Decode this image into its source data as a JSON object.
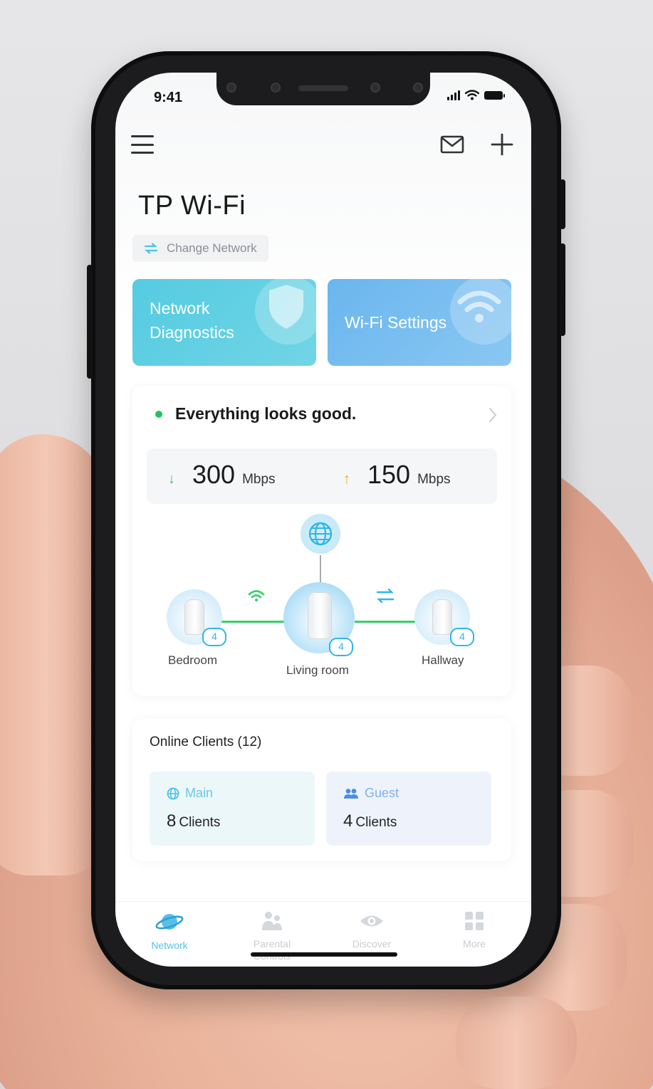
{
  "status_bar": {
    "time": "9:41"
  },
  "header": {
    "app_title": "TP Wi-Fi",
    "change_network_label": "Change Network"
  },
  "quick_actions": [
    {
      "label_line1": "Network",
      "label_line2": "Diagnostics",
      "icon": "shield-icon"
    },
    {
      "label": "Wi-Fi Settings",
      "icon": "wifi-icon"
    }
  ],
  "network_status": {
    "message": "Everything looks good.",
    "download": {
      "value": "300",
      "unit": "Mbps"
    },
    "upload": {
      "value": "150",
      "unit": "Mbps"
    }
  },
  "topology": {
    "nodes": [
      {
        "label": "Bedroom",
        "clients": "4"
      },
      {
        "label": "Living room",
        "clients": "4"
      },
      {
        "label": "Hallway",
        "clients": "4"
      }
    ]
  },
  "online_clients": {
    "title": "Online Clients (12)",
    "groups": [
      {
        "name": "Main",
        "count": "8",
        "count_label": "Clients"
      },
      {
        "name": "Guest",
        "count": "4",
        "count_label": "Clients"
      }
    ]
  },
  "tabbar": {
    "tabs": [
      {
        "label": "Network"
      },
      {
        "label": "Parental Controls"
      },
      {
        "label": "Discover"
      },
      {
        "label": "More"
      }
    ]
  },
  "colors": {
    "accent": "#56c0e6",
    "diagnostics_card": "#55cbe1",
    "wifi_card": "#6ab6ee",
    "status_green": "#21c45a",
    "link_green": "#36d06a"
  }
}
